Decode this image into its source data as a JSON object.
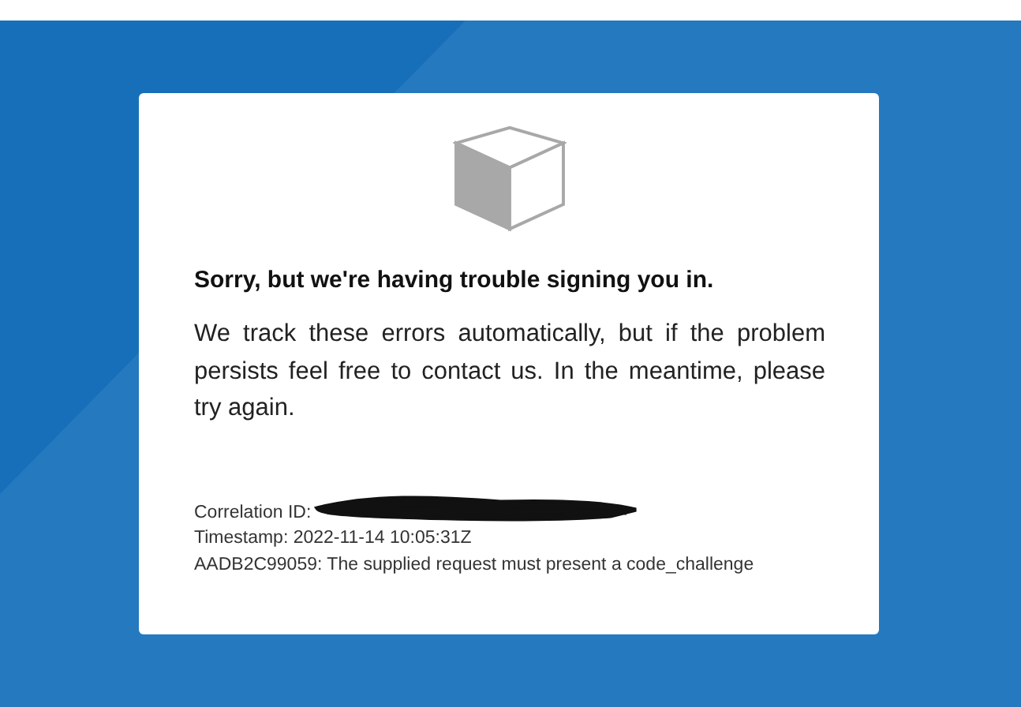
{
  "error_card": {
    "heading": "Sorry, but we're having trouble signing you in.",
    "message": "We track these errors automatically, but if the problem persists feel free to contact us. In the meantime, please try again.",
    "details": [
      {
        "text": "Correlation ID:",
        "redacted": true
      },
      {
        "text": "Timestamp: 2022-11-14 10:05:31Z",
        "redacted": false
      },
      {
        "text": "AADB2C99059: The supplied request must present a code_challenge",
        "redacted": false
      }
    ]
  }
}
